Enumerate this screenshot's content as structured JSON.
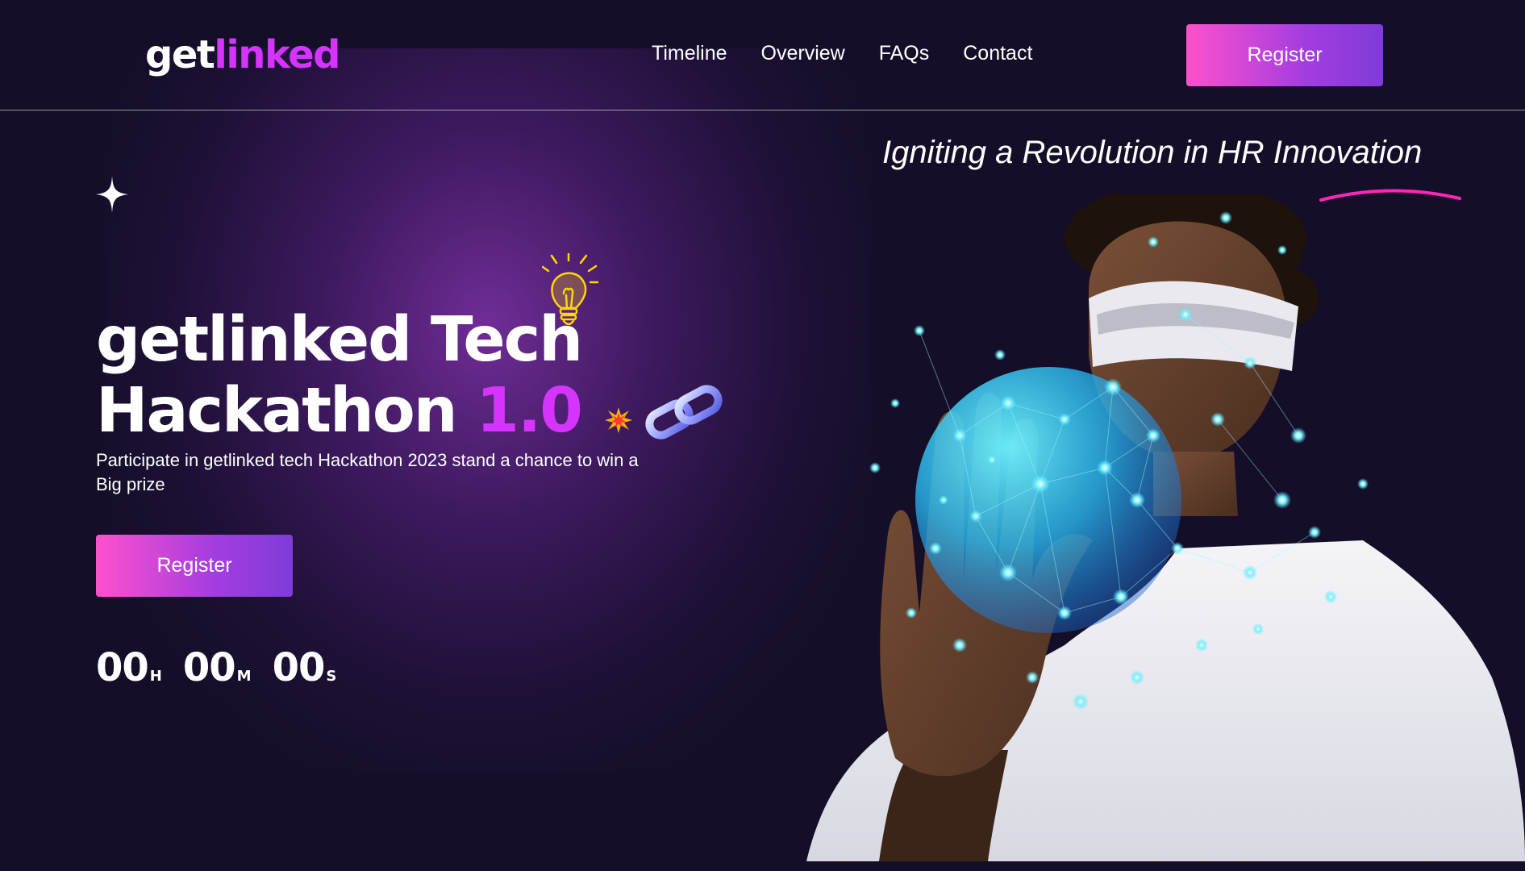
{
  "brand": {
    "part1": "get",
    "part2": "linked"
  },
  "nav": {
    "items": [
      {
        "label": "Timeline"
      },
      {
        "label": "Overview"
      },
      {
        "label": "FAQs"
      },
      {
        "label": "Contact"
      }
    ],
    "register_label": "Register"
  },
  "hero": {
    "tagline": "Igniting a Revolution in HR Innovation",
    "title_line1": "getlinked Tech",
    "title_line2": "Hackathon",
    "title_version": "1.0",
    "subtitle": "Participate in getlinked tech Hackathon 2023 stand a chance to win a Big prize",
    "register_label": "Register",
    "countdown": {
      "hours": "00",
      "hours_unit": "H",
      "minutes": "00",
      "minutes_unit": "M",
      "seconds": "00",
      "seconds_unit": "S"
    }
  },
  "colors": {
    "background": "#150e28",
    "accent": "#d434fe",
    "gradient_start": "#fd51cc",
    "gradient_end": "#7f3bd8",
    "underline": "#ff26b9",
    "bulb": "#ffd700",
    "network": "#4de8ff"
  },
  "icons": [
    "star-icon",
    "lightbulb-icon",
    "spark-icon",
    "chain-link-icon"
  ]
}
